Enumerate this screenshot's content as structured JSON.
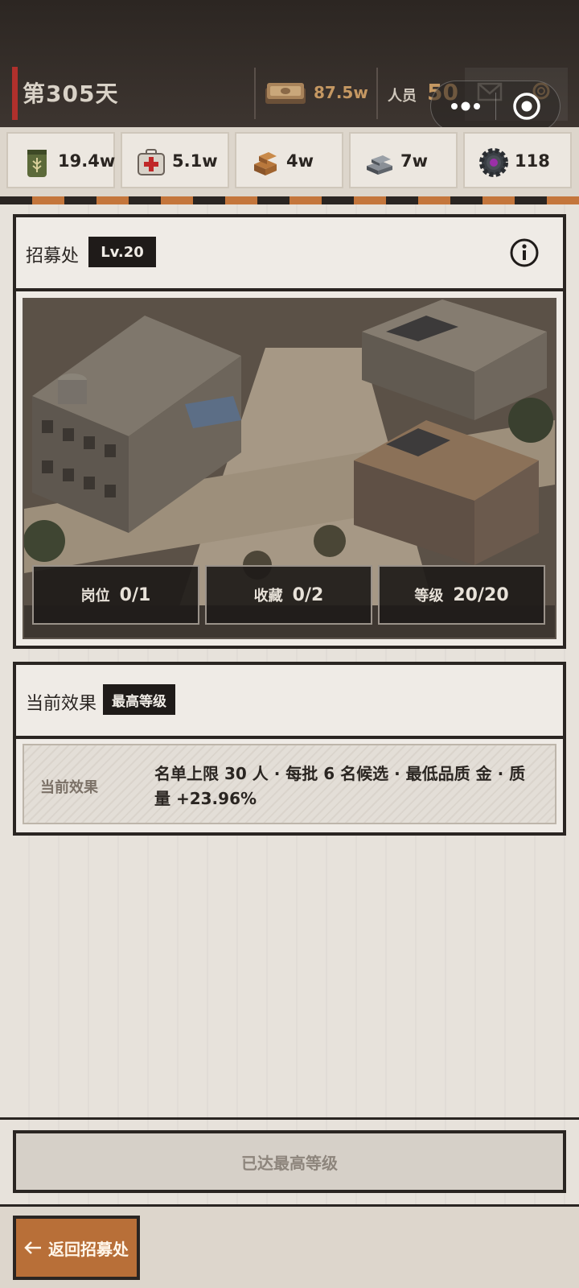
{
  "topbar": {
    "day": "第305天",
    "money_value": "87.5w",
    "staff_label": "人员",
    "staff_value": "50"
  },
  "resources": [
    {
      "icon": "grain-sack-icon",
      "value": "19.4w"
    },
    {
      "icon": "medkit-icon",
      "value": "5.1w"
    },
    {
      "icon": "wood-planks-icon",
      "value": "4w"
    },
    {
      "icon": "steel-ingots-icon",
      "value": "7w"
    },
    {
      "icon": "gear-part-icon",
      "value": "118"
    }
  ],
  "recruit_panel": {
    "title": "招募处",
    "level": "Lv.20",
    "stats": [
      {
        "label": "岗位",
        "value": "0/1"
      },
      {
        "label": "收藏",
        "value": "0/2"
      },
      {
        "label": "等级",
        "value": "20/20"
      }
    ]
  },
  "effect_panel": {
    "title": "当前效果",
    "badge": "最高等级",
    "row_label": "当前效果",
    "text": "名单上限 30 人 · 每批 6 名候选 · 最低品质 金 · 质量 +23.96%"
  },
  "buttons": {
    "max_level": "已达最高等级",
    "back": "返回招募处"
  },
  "colors": {
    "accent_orange": "#b86f38",
    "dark": "#2a2522",
    "gold_text": "#c59862",
    "day_accent": "#b0302c"
  }
}
